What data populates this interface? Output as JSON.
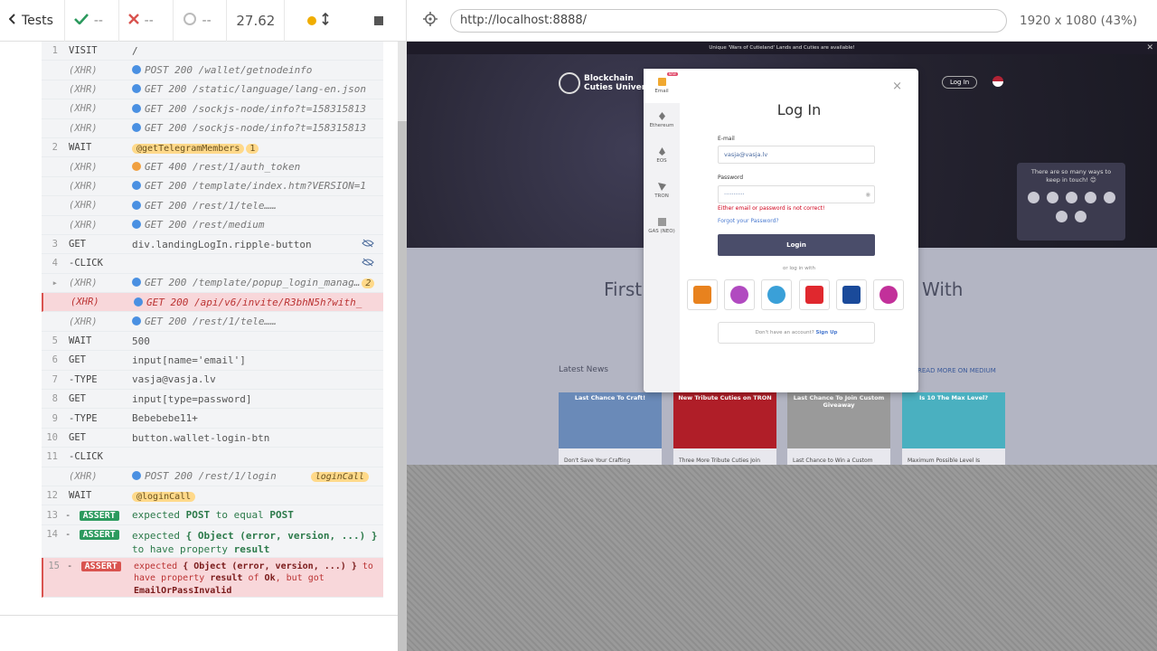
{
  "topbar": {
    "tests_label": "Tests",
    "passed": "--",
    "failed": "--",
    "pending": "--",
    "duration": "27.62",
    "url": "http://localhost:8888/",
    "viewport": "1920 x 1080",
    "scale": "(43%)"
  },
  "log": {
    "rows": [
      {
        "num": "1",
        "cmd": "VISIT",
        "msg": "/"
      },
      {
        "num": "",
        "cmd": "(XHR)",
        "msg": "POST 200 /wallet/getnodeinfo"
      },
      {
        "num": "",
        "cmd": "(XHR)",
        "msg": "GET 200 /static/language/lang-en.json"
      },
      {
        "num": "",
        "cmd": "(XHR)",
        "msg": "GET 200 /sockjs-node/info?t=158315813"
      },
      {
        "num": "",
        "cmd": "(XHR)",
        "msg": "GET 200 /sockjs-node/info?t=158315813"
      },
      {
        "num": "2",
        "cmd": "WAIT",
        "msg": "@getTelegramMembers",
        "count": "1"
      },
      {
        "num": "",
        "cmd": "(XHR)",
        "msg": "GET 400 /rest/1/auth_token"
      },
      {
        "num": "",
        "cmd": "(XHR)",
        "msg": "GET 200 /template/index.htm?VERSION=1"
      },
      {
        "num": "",
        "cmd": "(XHR)",
        "msg": "GET 200 /rest/1/tele…",
        "alias": "getTelegramMembers"
      },
      {
        "num": "",
        "cmd": "(XHR)",
        "msg": "GET 200 /rest/medium"
      },
      {
        "num": "3",
        "cmd": "GET",
        "msg": "div.landingLogIn.ripple-button"
      },
      {
        "num": "4",
        "cmd": "-CLICK",
        "msg": ""
      },
      {
        "num": "",
        "cmd": "(XHR)",
        "msg": "GET 200 /template/popup_login_manag…",
        "count": "2"
      },
      {
        "num": "",
        "cmd": "(XHR)",
        "msg": "GET 200 /api/v6/invite/R3bhN5h?with_"
      },
      {
        "num": "",
        "cmd": "(XHR)",
        "msg": "GET 200 /rest/1/tele…",
        "alias": "getTelegramMembers"
      },
      {
        "num": "5",
        "cmd": "WAIT",
        "msg": "500"
      },
      {
        "num": "6",
        "cmd": "GET",
        "msg": "input[name='email']"
      },
      {
        "num": "7",
        "cmd": "-TYPE",
        "msg": "vasja@vasja.lv"
      },
      {
        "num": "8",
        "cmd": "GET",
        "msg": "input[type=password]"
      },
      {
        "num": "9",
        "cmd": "-TYPE",
        "msg": "Bebebebe11+"
      },
      {
        "num": "10",
        "cmd": "GET",
        "msg": "button.wallet-login-btn"
      },
      {
        "num": "11",
        "cmd": "-CLICK",
        "msg": ""
      },
      {
        "num": "",
        "cmd": "(XHR)",
        "msg": "POST 200 /rest/1/login",
        "alias": "loginCall"
      },
      {
        "num": "12",
        "cmd": "WAIT",
        "msg": "@loginCall"
      }
    ],
    "assert13": {
      "num": "13",
      "label": "ASSERT",
      "text1": "expected",
      "v1": "POST",
      "text2": "to equal",
      "v2": "POST"
    },
    "assert14": {
      "num": "14",
      "label": "ASSERT",
      "text1": "expected",
      "v1": "{ Object (error, version, ...) }",
      "text2": "to have property",
      "v2": "result"
    },
    "assert15": {
      "num": "15",
      "label": "ASSERT",
      "text1": "expected",
      "v1": "{ Object (error, version, ...) }",
      "text2": "to have property",
      "v2": "result",
      "text3": "of",
      "v3": "Ok",
      "text4": ", but got",
      "v4": "EmailOrPassInvalid"
    }
  },
  "aut": {
    "banner": "Unique 'Wars of Cutieland' Lands and Cuties are available!",
    "logo_line1": "Blockchain",
    "logo_line2": "Cuties Universe",
    "hero_login": "Log In",
    "social_text": "There are so many ways to keep in touch! 😊",
    "first_text": "First",
    "with_text": "With",
    "latest_news": "Latest News",
    "read_more": "READ MORE ON MEDIUM",
    "news": [
      {
        "title": "Last Chance To Craft!",
        "caption": "Don't Save Your Crafting",
        "color": "#6a8ab8"
      },
      {
        "title": "New Tribute Cuties on TRON",
        "caption": "Three More Tribute Cuties Join",
        "color": "#b01e28"
      },
      {
        "title": "Last Chance To Join Custom Giveaway",
        "caption": "Last Chance to Win a Custom",
        "color": "#9a9a9a"
      },
      {
        "title": "Is 10 The Max Level?",
        "caption": "Maximum Possible Level Is",
        "color": "#4ab0c0"
      }
    ],
    "modal": {
      "title": "Log In",
      "side": [
        "Email",
        "Ethereum",
        "EOS",
        "TRON",
        "GAS (NEO)"
      ],
      "new_tag": "NEW",
      "email_label": "E-mail",
      "email_value": "vasja@vasja.lv",
      "password_label": "Password",
      "password_value": "···········",
      "error": "Either email or password is not correct!",
      "forgot": "Forgot your Password?",
      "login_button": "Login",
      "or_login": "or log in with",
      "signup_prompt": "Don't have an account?",
      "signup_link": "Sign Up",
      "wallets": [
        "#e8821e",
        "#b14ac0",
        "#3aa0d8",
        "#e0282e",
        "#1a4a9a",
        "#c2309a"
      ]
    }
  }
}
